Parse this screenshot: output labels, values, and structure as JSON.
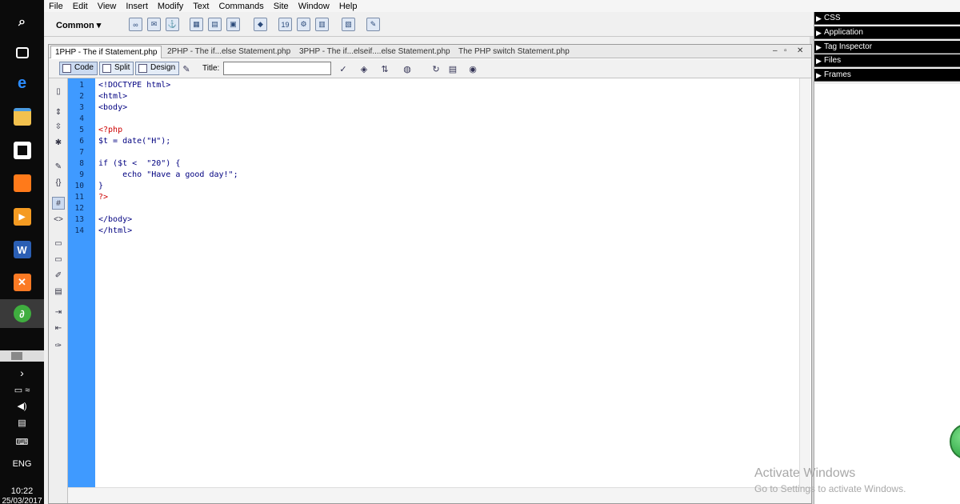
{
  "menubar": [
    "File",
    "Edit",
    "View",
    "Insert",
    "Modify",
    "Text",
    "Commands",
    "Site",
    "Window",
    "Help"
  ],
  "insertbar": {
    "category": "Common"
  },
  "tabs": [
    "1PHP - The if Statement.php",
    "2PHP - The if...else Statement.php",
    "3PHP - The if...elseif....else Statement.php",
    "The PHP switch Statement.php"
  ],
  "doc_toolbar": {
    "code_label": "Code",
    "split_label": "Split",
    "design_label": "Design",
    "title_label": "Title:",
    "title_value": ""
  },
  "line_numbers": [
    "1",
    "2",
    "3",
    "4",
    "5",
    "6",
    "7",
    "8",
    "9",
    "10",
    "11",
    "12",
    "13",
    "14"
  ],
  "code_lines": [
    "<!DOCTYPE html>",
    "<html>",
    "<body>",
    "",
    "<?php",
    "$t = date(\"H\");",
    "",
    "if ($t <  \"20\") {",
    "     echo \"Have a good day!\";",
    "}",
    "?>",
    "",
    "</body>",
    "</html>"
  ],
  "panels": [
    "CSS",
    "Application",
    "Tag Inspector",
    "Files",
    "Frames"
  ],
  "tray": {
    "language": "ENG",
    "time": "10:22",
    "date": "25/03/2017"
  },
  "watermark": {
    "line1": "Activate Windows",
    "line2": "Go to Settings to activate Windows."
  },
  "colors": {
    "gutter": "#3f9aff",
    "tag": "#000080",
    "php": "#cc0000"
  }
}
